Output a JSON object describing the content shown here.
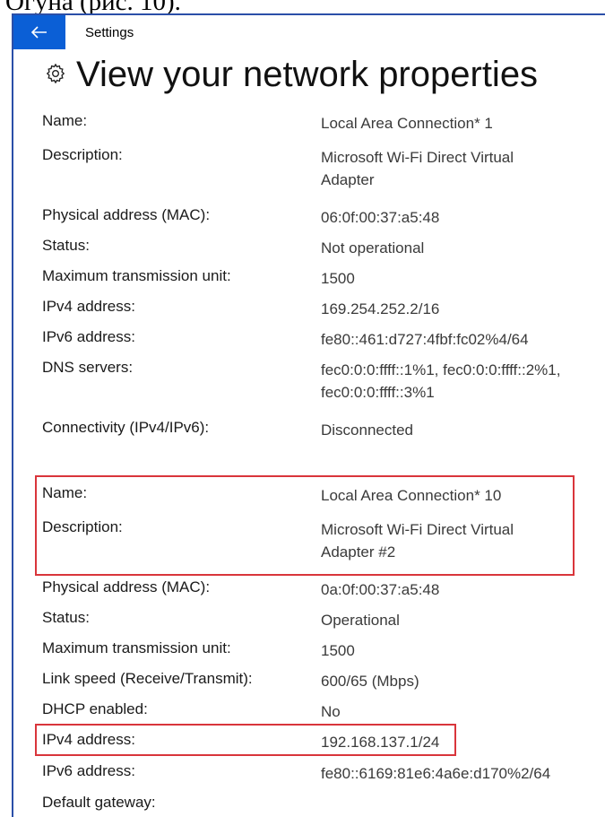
{
  "fragment_text": "Огуна (рис. 10).",
  "window": {
    "title": "Settings",
    "back_label": "←",
    "accent": "#0b5fd6"
  },
  "page": {
    "title": "View your network properties",
    "icon": "gear-icon"
  },
  "adapter1": {
    "name_label": "Name:",
    "name_value": "Local Area Connection* 1",
    "desc_label": "Description:",
    "desc_value_1": "Microsoft Wi-Fi Direct Virtual",
    "desc_value_2": "Adapter",
    "mac_label": "Physical address (MAC):",
    "mac_value": "06:0f:00:37:a5:48",
    "status_label": "Status:",
    "status_value": "Not operational",
    "mtu_label": "Maximum transmission unit:",
    "mtu_value": "1500",
    "ipv4_label": "IPv4 address:",
    "ipv4_value": "169.254.252.2/16",
    "ipv6_label": "IPv6 address:",
    "ipv6_value": "fe80::461:d727:4fbf:fc02%4/64",
    "dns_label": "DNS servers:",
    "dns_value_1": "fec0:0:0:ffff::1%1, fec0:0:0:ffff::2%1,",
    "dns_value_2": "fec0:0:0:ffff::3%1",
    "conn_label": "Connectivity (IPv4/IPv6):",
    "conn_value": "Disconnected"
  },
  "adapter2": {
    "name_label": "Name:",
    "name_value": "Local Area Connection* 10",
    "desc_label": "Description:",
    "desc_value_1": "Microsoft Wi-Fi Direct Virtual",
    "desc_value_2": "Adapter #2",
    "mac_label": "Physical address (MAC):",
    "mac_value": "0a:0f:00:37:a5:48",
    "status_label": "Status:",
    "status_value": "Operational",
    "mtu_label": "Maximum transmission unit:",
    "mtu_value": "1500",
    "link_label": "Link speed (Receive/Transmit):",
    "link_value": "600/65 (Mbps)",
    "dhcp_label": "DHCP enabled:",
    "dhcp_value": "No",
    "ipv4_label": "IPv4 address:",
    "ipv4_value": "192.168.137.1/24",
    "ipv6_label": "IPv6 address:",
    "ipv6_value": "fe80::6169:81e6:4a6e:d170%2/64",
    "gw_label": "Default gateway:"
  },
  "colors": {
    "highlight": "#d9353b",
    "window_border": "#2b4fa8"
  }
}
